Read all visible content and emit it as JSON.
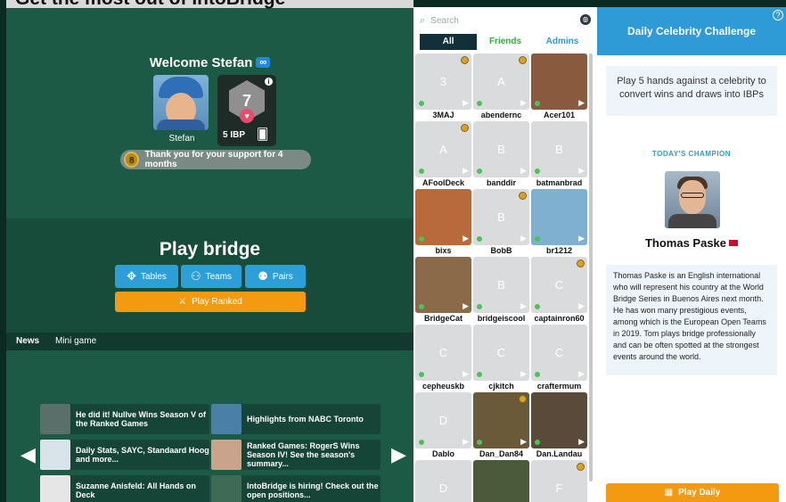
{
  "top_strip": {
    "text": "Get the most out of IntoBridge"
  },
  "welcome": {
    "text": "Welcome Stefan",
    "badge": "∞"
  },
  "profile": {
    "name": "Stefan",
    "ibp_value": "7",
    "ibp_label": "5 IBP"
  },
  "support": {
    "text": "Thank you for your support for 4 months"
  },
  "play": {
    "title": "Play bridge",
    "tables": "Tables",
    "teams": "Teams",
    "pairs": "Pairs",
    "ranked": "Play Ranked"
  },
  "tabs": {
    "news": "News",
    "minigame": "Mini game"
  },
  "news": [
    {
      "text": "He did it! Nullve Wins Season V of the Ranked Games",
      "color": "#5a6e6a"
    },
    {
      "text": "Highlights from NABC Toronto",
      "color": "#4a7fa8"
    },
    {
      "text": "Daily Stats, SAYC, Standaard Hoog and more...",
      "color": "#d9e4ea"
    },
    {
      "text": "Ranked Games: RogerS Wins Season IV! See the season's summary...",
      "color": "#c9a48a"
    },
    {
      "text": "Suzanne Anisfeld: All Hands on Deck",
      "color": "#e6e6e6"
    },
    {
      "text": "IntoBridge is hiring! Check out the open positions...",
      "color": "#3f6a55"
    }
  ],
  "people": {
    "search_placeholder": "Search",
    "filters": [
      "All",
      "Friends",
      "Admins"
    ],
    "users": [
      {
        "name": "3MAJ",
        "letter": "3",
        "color": "#d9dbdc",
        "medal": true
      },
      {
        "name": "abendernc",
        "letter": "A",
        "color": "#d9dbdc",
        "medal": true
      },
      {
        "name": "Acer101",
        "letter": "",
        "color": "#8a5a3f",
        "medal": false
      },
      {
        "name": "AFoolDeck",
        "letter": "A",
        "color": "#d9dbdc",
        "medal": true
      },
      {
        "name": "banddir",
        "letter": "B",
        "color": "#d9dbdc",
        "medal": false
      },
      {
        "name": "batmanbrad",
        "letter": "B",
        "color": "#d9dbdc",
        "medal": false
      },
      {
        "name": "bixs",
        "letter": "",
        "color": "#b86a3c",
        "medal": false
      },
      {
        "name": "BobB",
        "letter": "B",
        "color": "#d9dbdc",
        "medal": true
      },
      {
        "name": "br1212",
        "letter": "",
        "color": "#7fb0cf",
        "medal": false
      },
      {
        "name": "BridgeCat",
        "letter": "",
        "color": "#8b6a4a",
        "medal": false
      },
      {
        "name": "bridgeiscool",
        "letter": "B",
        "color": "#d9dbdc",
        "medal": false
      },
      {
        "name": "captainron60",
        "letter": "C",
        "color": "#d9dbdc",
        "medal": true
      },
      {
        "name": "cepheuskb",
        "letter": "C",
        "color": "#d9dbdc",
        "medal": false
      },
      {
        "name": "cjkitch",
        "letter": "C",
        "color": "#d9dbdc",
        "medal": false
      },
      {
        "name": "craftermum",
        "letter": "C",
        "color": "#d9dbdc",
        "medal": false
      },
      {
        "name": "Dablo",
        "letter": "D",
        "color": "#d9dbdc",
        "medal": false
      },
      {
        "name": "Dan_Dan84",
        "letter": "",
        "color": "#6a5a3a",
        "medal": true
      },
      {
        "name": "Dan.Landau",
        "letter": "",
        "color": "#5a4a3a",
        "medal": false
      },
      {
        "name": "",
        "letter": "D",
        "color": "#d9dbdc",
        "medal": false
      },
      {
        "name": "",
        "letter": "",
        "color": "#4a5a3a",
        "medal": false
      },
      {
        "name": "",
        "letter": "F",
        "color": "#d9dbdc",
        "medal": true
      }
    ]
  },
  "challenge": {
    "title": "Daily Celebrity Challenge",
    "intro": "Play 5 hands against a celebrity to convert wins and draws into IBPs",
    "champion_label": "TODAY'S CHAMPION",
    "champion_name": "Thomas Paske",
    "bio": "Thomas Paske is an English international who will represent his country at the World Bridge Series in Buenos Aires next month. He has won many prestigious events, among which is the European Open Teams in 2019. Tom plays bridge professionally and can be often spotted at the strongest events around the world.",
    "button": "Play Daily"
  },
  "colors": {
    "accent": "#2e9ad6",
    "orange": "#f39a10",
    "green_bg": "#1d5a45"
  }
}
